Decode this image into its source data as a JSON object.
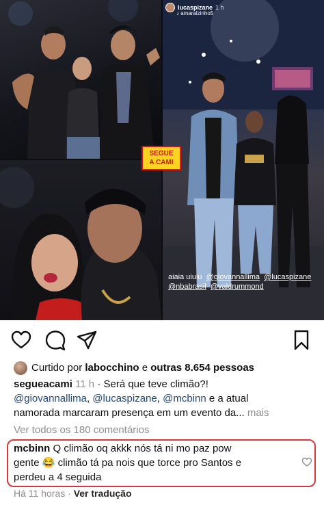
{
  "story": {
    "username": "lucaspizane",
    "time": "1 h",
    "music": "amaralzinho5",
    "mentions": [
      "aiaia uiuiu",
      "@giovannallima",
      "@lucaspizane",
      "@nbabrasil",
      "@valdrummond"
    ]
  },
  "sticker": {
    "line1": "SEGUE",
    "line2": "A CAMI"
  },
  "actions": [
    "heart-icon",
    "comment-icon",
    "share-icon",
    "bookmark-icon"
  ],
  "likes": {
    "prefix": "Curtido por",
    "user": "labocchino",
    "connector": "e",
    "others": "outras 8.654 pessoas"
  },
  "post": {
    "author": "segueacami",
    "time": "11 h",
    "caption_line1": "· Será que teve climão?!",
    "mention1": "@giovannallima",
    "mention2": "@lucaspizane",
    "mention3": "@mcbinn",
    "caption_line2_tail": "e a atual",
    "caption_line3": "namorada marcaram presença em um evento da...",
    "more": "mais"
  },
  "view_comments": "Ver todos os 180 comentários",
  "comment": {
    "author": "mcbinn",
    "line1": "Q climão oq akkk nós tá ni mo paz pow",
    "line2a": "gente",
    "emoji": "😂",
    "line2b": "climão tá pa nois que torce pro Santos e",
    "line3": "perdeu a 4 seguida"
  },
  "footer": {
    "time": "Há 11 horas",
    "separator": "·",
    "translate": "Ver tradução"
  },
  "colors": {
    "link": "#25487a",
    "highlight_border": "#d9363a",
    "muted": "#8e8e8e",
    "sticker_yellow": "#ffd21f",
    "sticker_red": "#d2140c"
  }
}
